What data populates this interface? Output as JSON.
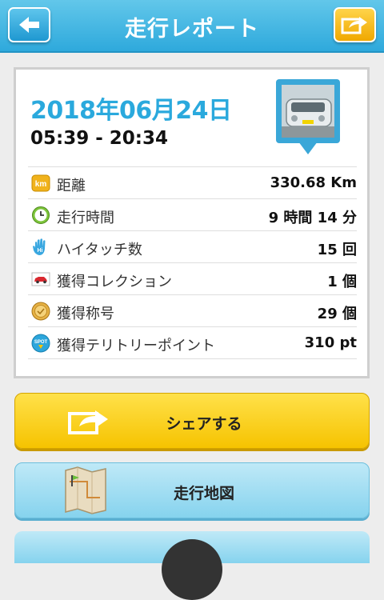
{
  "header": {
    "title": "走行レポート",
    "back_icon": "arrow-left-icon",
    "share_icon": "share-arrow-icon"
  },
  "report": {
    "date": "2018年06月24日",
    "time_range": "05:39 - 20:34",
    "photo_icon": "car-photo-pin",
    "stats": [
      {
        "icon": "km-badge-icon",
        "label": "距離",
        "value": "330.68 Km"
      },
      {
        "icon": "clock-icon",
        "label": "走行時間",
        "value": "9 時間 14 分"
      },
      {
        "icon": "hand-hi-icon",
        "label": "ハイタッチ数",
        "value": "15 回"
      },
      {
        "icon": "car-collection-icon",
        "label": "獲得コレクション",
        "value": "1 個"
      },
      {
        "icon": "medal-icon",
        "label": "獲得称号",
        "value": "29 個"
      },
      {
        "icon": "spot-badge-icon",
        "label": "獲得テリトリーポイント",
        "value": "310 pt"
      }
    ]
  },
  "actions": {
    "share_label": "シェアする",
    "map_label": "走行地図"
  },
  "colors": {
    "header": "#2ea9dc",
    "date": "#2aa9dd",
    "share_button": "#f6c300",
    "map_button": "#86d3ee"
  }
}
